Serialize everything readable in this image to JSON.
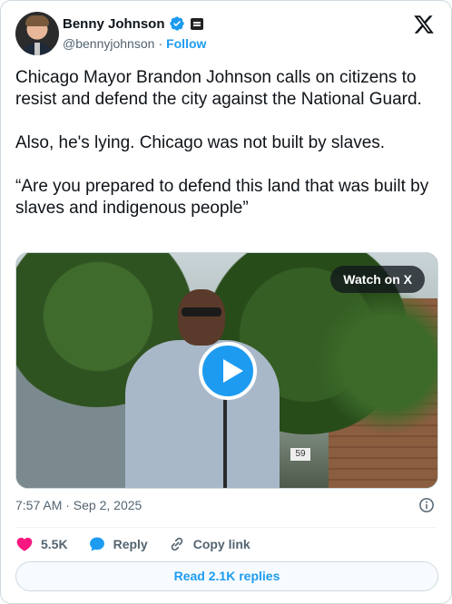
{
  "author": {
    "name": "Benny Johnson",
    "handle": "@bennyjohnson",
    "separator": "·",
    "follow_label": "Follow"
  },
  "post": {
    "text": "Chicago Mayor Brandon Johnson calls on citizens to resist and defend the city against the National Guard.\n\nAlso, he's lying. Chicago was not built by slaves.\n\n“Are you prepared to defend this land that was built by slaves and indigenous people”",
    "timestamp": "7:57 AM · Sep 2, 2025"
  },
  "media": {
    "watch_label": "Watch on X",
    "address_number": "59"
  },
  "actions": {
    "likes": "5.5K",
    "reply_label": "Reply",
    "copy_link_label": "Copy link"
  },
  "replies_button": "Read 2.1K replies",
  "colors": {
    "accent": "#1d9bf0",
    "like": "#f91880",
    "text_secondary": "#536471"
  },
  "icons": [
    "verified-badge-icon",
    "x-logo-icon",
    "play-icon",
    "info-icon",
    "heart-icon",
    "reply-icon",
    "link-icon"
  ]
}
